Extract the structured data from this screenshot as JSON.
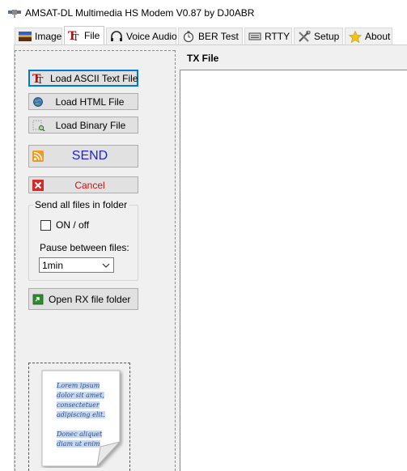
{
  "window": {
    "title": "AMSAT-DL Multimedia HS Modem V0.87 by DJ0ABR"
  },
  "tabs": [
    {
      "label": "Image",
      "icon": "image-icon"
    },
    {
      "label": "File",
      "icon": "text-file-icon",
      "active": true
    },
    {
      "label": "Voice Audio",
      "icon": "headphones-icon"
    },
    {
      "label": "BER Test",
      "icon": "stopwatch-icon"
    },
    {
      "label": "RTTY",
      "icon": "keyboard-icon"
    },
    {
      "label": "Setup",
      "icon": "tools-icon"
    },
    {
      "label": "About",
      "icon": "star-icon"
    }
  ],
  "file_panel": {
    "load_ascii": "Load ASCII Text File",
    "load_html": "Load HTML File",
    "load_binary": "Load Binary File",
    "send": "SEND",
    "cancel": "Cancel",
    "folder_group": {
      "title": "Send all files in folder",
      "on_off_label": "ON / off",
      "on_off_checked": false,
      "pause_label": "Pause between files:",
      "pause_value": "1min"
    },
    "open_rx": "Open RX file folder"
  },
  "tx": {
    "label": "TX File",
    "content": ""
  },
  "preview": {
    "lines": [
      "Lorem ipsum",
      "dolor sit amet,",
      "consectetuer",
      "adipiscing elit.",
      "",
      "Donec aliquet",
      "diam ut enim"
    ]
  },
  "colors": {
    "send_text": "#1f1fe0",
    "cancel_text": "#d01010",
    "focus_border": "#0078d7"
  }
}
